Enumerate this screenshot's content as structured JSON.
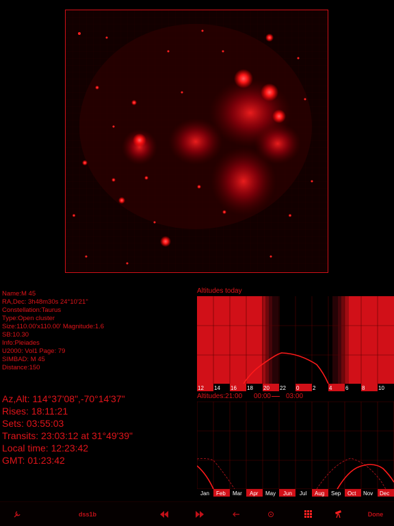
{
  "object": {
    "lines": [
      "Name:M 45",
      "RA,Dec:  3h48m30s  24°10'21\"",
      "Constellation:Taurus",
      "Type:Open cluster",
      "Size:110.00'x110.00' Magnitude:1.6",
      "SB:10.30",
      "Info:Pleiades",
      "U2000: Vol1 Page: 79",
      "SIMBAD: M 45",
      "Distance:150"
    ]
  },
  "position": {
    "lines": [
      "Az,Alt: 114°37'08\",-70°14'37\"",
      "Rises:     18:11:21",
      "Sets:      03:55:03",
      "Transits:     23:03:12 at  31°49'39\"",
      "Local time:    12:23:42",
      "GMT:      01:23:42"
    ]
  },
  "altitudes_today": {
    "title": "Altitudes today",
    "hour_labels": [
      "12",
      "14",
      "16",
      "18",
      "20",
      "22",
      "0",
      "2",
      "4",
      "6",
      "8",
      "10"
    ]
  },
  "altitudes_year": {
    "title": "Altitudes:21:00",
    "range_start": "00:00",
    "range_end": "03:00",
    "month_labels": [
      "Jan",
      "Feb",
      "Mar",
      "Apr",
      "May",
      "Jun",
      "Jul",
      "Aug",
      "Sep",
      "Oct",
      "Nov",
      "Dec"
    ]
  },
  "toolbar": {
    "survey_label": "dss1b",
    "done_label": "Done"
  },
  "colors": {
    "accent": "#e0141a",
    "background": "#000000"
  }
}
